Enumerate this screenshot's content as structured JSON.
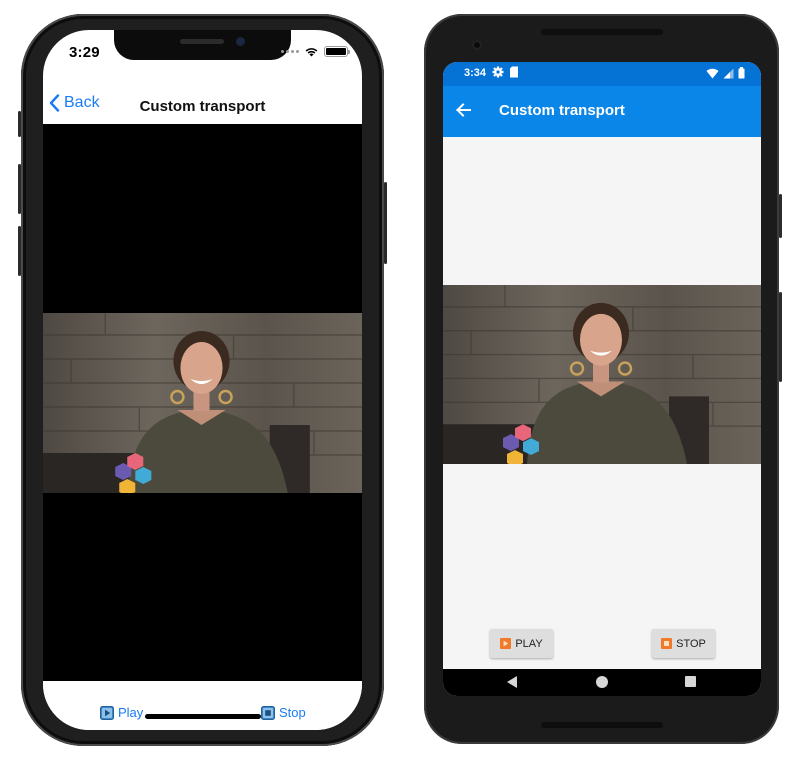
{
  "ios": {
    "status_time": "3:29",
    "back_label": "Back",
    "title": "Custom transport",
    "play_label": "Play",
    "stop_label": "Stop"
  },
  "android": {
    "status_time": "3:34",
    "title": "Custom transport",
    "play_label": "PLAY",
    "stop_label": "STOP"
  },
  "colors": {
    "ios_accent": "#1a7cf5",
    "android_appbar": "#0a85e8",
    "android_statusbar": "#0572d6",
    "media_icon_orange": "#f07a2a"
  },
  "icons": [
    "chevron-left-icon",
    "wifi-icon",
    "battery-icon",
    "gear-icon",
    "sd-card-icon",
    "signal-icon",
    "arrow-left-icon",
    "play-icon",
    "stop-icon",
    "nav-back-icon",
    "nav-home-icon",
    "nav-recents-icon"
  ]
}
